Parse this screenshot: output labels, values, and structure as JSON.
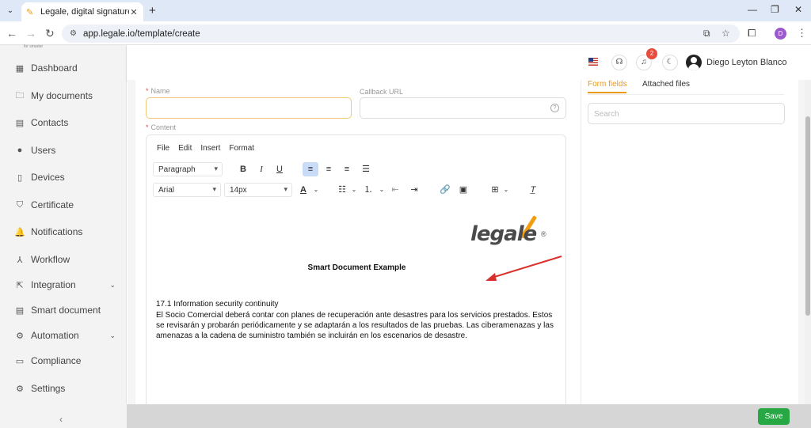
{
  "browser": {
    "tab_title": "Legale, digital signature",
    "url": "app.legale.io/template/create",
    "profile_initial": "D",
    "tab_list_icon": "chevron-down-icon",
    "new_tab_icon": "plus-icon",
    "window_controls": [
      "minimize-icon",
      "restore-icon",
      "close-icon"
    ]
  },
  "sidebar": {
    "logo_tagline": "for smarter",
    "items": [
      {
        "label": "Dashboard",
        "icon": "dashboard-icon"
      },
      {
        "label": "My documents",
        "icon": "folder-icon"
      },
      {
        "label": "Contacts",
        "icon": "contacts-icon"
      },
      {
        "label": "Users",
        "icon": "user-icon"
      },
      {
        "label": "Devices",
        "icon": "device-icon"
      },
      {
        "label": "Certificate",
        "icon": "shield-icon"
      },
      {
        "label": "Notifications",
        "icon": "bell-icon"
      },
      {
        "label": "Workflow",
        "icon": "workflow-icon"
      },
      {
        "label": "Integration",
        "icon": "external-icon",
        "expandable": true
      },
      {
        "label": "Smart document",
        "icon": "smart-document-icon"
      },
      {
        "label": "Automation",
        "icon": "gear-icon",
        "expandable": true
      },
      {
        "label": "Compliance",
        "icon": "chat-icon"
      },
      {
        "label": "Settings",
        "icon": "settings-icon"
      }
    ],
    "collapse_icon": "chevron-left-icon"
  },
  "header": {
    "language": "EN-US",
    "notification_count": "2",
    "user_name": "Diego Leyton Blanco"
  },
  "form": {
    "name_label": "Name",
    "name_value": "",
    "callback_label": "Callback URL",
    "callback_value": "",
    "content_label": "Content",
    "required_mark": "*"
  },
  "editor": {
    "menu": [
      "File",
      "Edit",
      "Insert",
      "Format"
    ],
    "block_format": "Paragraph",
    "font_family": "Arial",
    "font_size": "14px",
    "alignment": "left"
  },
  "document": {
    "logo_text": "legale",
    "logo_mark": "®",
    "heading": "Smart Document Example",
    "section_title": "17.1 Information security continuity",
    "paragraph": "El Socio Comercial deberá contar con planes de recuperación ante desastres para los servicios prestados. Estos se revisarán y probarán periódicamente y se adaptarán a los resultados de las pruebas. Las ciberamenazas y las amenazas a la cadena de suministro también se incluirán en los escenarios de desastre.",
    "annotation_color": "#d9302c"
  },
  "right_panel": {
    "tabs": [
      "Form fields",
      "Attached files"
    ],
    "active_tab": "Form fields",
    "search_placeholder": "Search"
  },
  "footer": {
    "save_label": "Save"
  },
  "colors": {
    "accent": "#e89a1b",
    "save": "#28a745",
    "badge": "#e74c3c"
  }
}
